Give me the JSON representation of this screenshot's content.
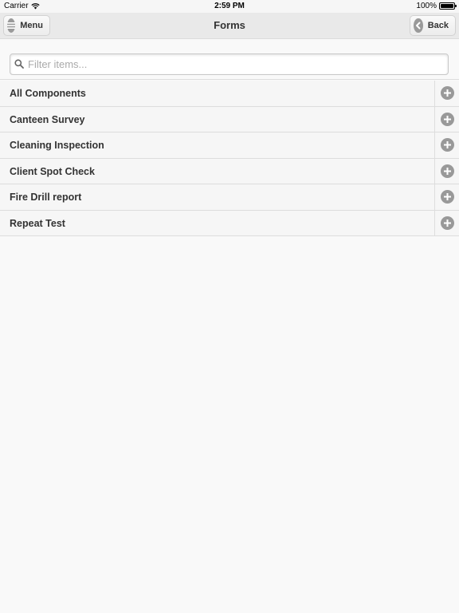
{
  "status_bar": {
    "carrier": "Carrier",
    "time": "2:59 PM",
    "battery": "100%"
  },
  "header": {
    "title": "Forms",
    "menu_label": "Menu",
    "back_label": "Back"
  },
  "search": {
    "placeholder": "Filter items..."
  },
  "forms": [
    {
      "label": "All Components"
    },
    {
      "label": "Canteen Survey"
    },
    {
      "label": "Cleaning Inspection"
    },
    {
      "label": "Client Spot Check"
    },
    {
      "label": "Fire Drill report"
    },
    {
      "label": "Repeat Test"
    }
  ],
  "icons": {
    "menu": "menu-icon",
    "back": "back-arrow-icon",
    "search": "search-icon",
    "add": "plus-circle-icon",
    "wifi": "wifi-icon",
    "battery": "battery-icon"
  },
  "colors": {
    "header_bg": "#e9e9e9",
    "row_bg": "#f6f6f6",
    "icon_gray": "#999999",
    "text": "#333333"
  }
}
